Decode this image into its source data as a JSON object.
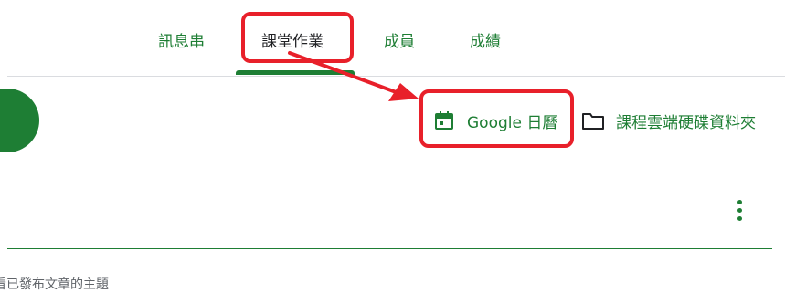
{
  "tabs": {
    "items": [
      {
        "label": "訊息串"
      },
      {
        "label": "課堂作業"
      },
      {
        "label": "成員"
      },
      {
        "label": "成績"
      }
    ],
    "active": "課堂作業"
  },
  "toolbar": {
    "calendar_label": "Google 日曆",
    "drive_label": "課程雲端硬碟資料夾"
  },
  "icons": {
    "calendar": "calendar-icon",
    "folder": "folder-icon",
    "more": "more-vertical-icon"
  },
  "body": {
    "bottom_text": "看已發布文章的主題"
  },
  "colors": {
    "accent": "#1e7e34",
    "annotation": "#e8202a",
    "divider": "#dadce0"
  }
}
